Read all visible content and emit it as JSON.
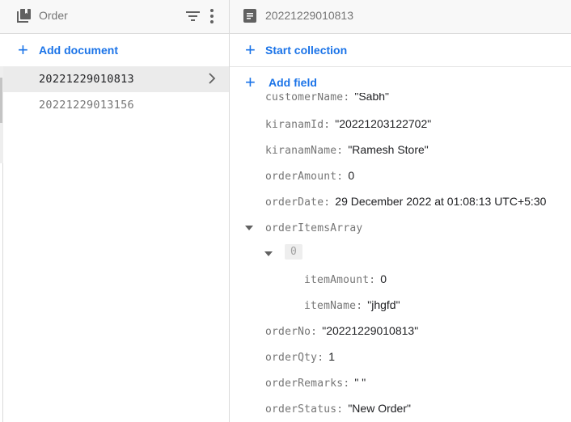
{
  "collection_panel": {
    "title": "Order",
    "add_document_label": "Add document",
    "documents": [
      {
        "id": "20221229010813",
        "selected": true
      },
      {
        "id": "20221229013156",
        "selected": false
      }
    ]
  },
  "document_panel": {
    "title": "20221229010813",
    "start_collection_label": "Start collection",
    "add_field_label": "Add field",
    "fields": [
      {
        "key": "customerName:",
        "value": "\"Sabh\"",
        "clipped": true
      },
      {
        "key": "kiranamId:",
        "value": "\"20221203122702\""
      },
      {
        "key": "kiranamName:",
        "value": "\"Ramesh Store\""
      },
      {
        "key": "orderAmount:",
        "value": "0"
      },
      {
        "key": "orderDate:",
        "value": "29 December 2022 at 01:08:13 UTC+5:30"
      },
      {
        "key": "orderItemsArray",
        "value": "",
        "expanded": true,
        "items": [
          {
            "index": "0",
            "expanded": true,
            "fields": [
              {
                "key": "itemAmount:",
                "value": "0"
              },
              {
                "key": "itemName:",
                "value": "\"jhgfd\""
              }
            ]
          }
        ]
      },
      {
        "key": "orderNo:",
        "value": "\"20221229010813\""
      },
      {
        "key": "orderQty:",
        "value": "1"
      },
      {
        "key": "orderRemarks:",
        "value": "\" \""
      },
      {
        "key": "orderStatus:",
        "value": "\"New Order\""
      }
    ]
  },
  "colors": {
    "accent": "#1a73e8",
    "header_bg": "#f8f8f8",
    "selected_bg": "#ebebeb",
    "key_text": "#757575",
    "value_text": "#202124"
  }
}
